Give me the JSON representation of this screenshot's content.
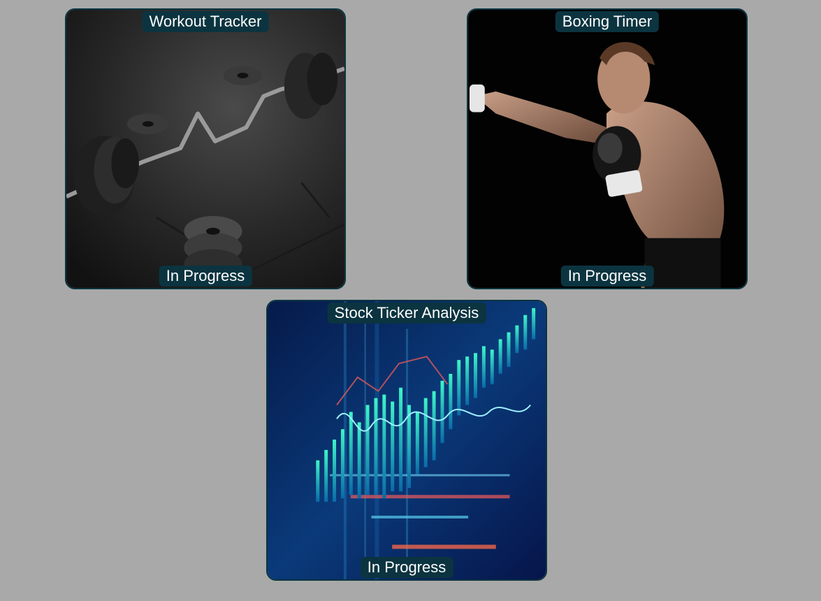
{
  "projects": [
    {
      "title": "Workout Tracker",
      "status": "In Progress",
      "image": "barbell-weights-image"
    },
    {
      "title": "Boxing Timer",
      "status": "In Progress",
      "image": "boxer-punching-image"
    },
    {
      "title": "Stock Ticker Analysis",
      "status": "In Progress",
      "image": "stock-chart-image"
    }
  ],
  "colors": {
    "page_background": "#a9a9a9",
    "pill_background": "#0b3440",
    "card_border": "#0b3440",
    "pill_text": "#ffffff"
  }
}
